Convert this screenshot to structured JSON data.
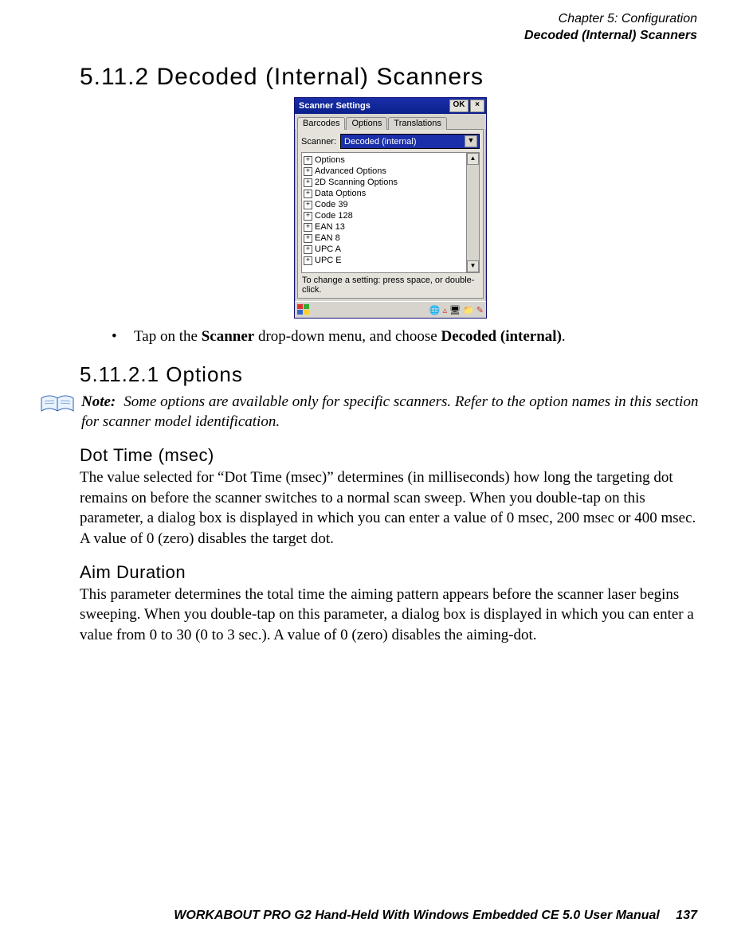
{
  "header": {
    "chapter": "Chapter 5: Configuration",
    "section_name": "Decoded (Internal) Scanners"
  },
  "h_5_11_2": "5.11.2  Decoded (Internal) Scanners",
  "instruction": {
    "pre": "Tap on the ",
    "bold1": "Scanner",
    "mid": " drop-down menu, and choose ",
    "bold2": "Decoded (internal)",
    "post": "."
  },
  "h_5_11_2_1": "5.11.2.1  Options",
  "note": {
    "label": "Note:",
    "text": "Some options are available only for specific scanners. Refer to the option names in this section for scanner model identification."
  },
  "dot_time": {
    "heading": "Dot Time (msec)",
    "body": "The value selected for “Dot Time (msec)” determines (in milliseconds) how long the targeting dot remains on before the scanner switches to a normal scan sweep. When you double-tap on this parameter, a dialog box is displayed in which you can enter a value of 0 msec, 200 msec or 400 msec. A value of 0 (zero) disables the target dot."
  },
  "aim": {
    "heading": "Aim Duration",
    "body": "This parameter determines the total time the aiming pattern appears before the scanner laser begins sweeping. When you double-tap on this parameter, a dialog box is displayed in which you can enter a value from 0 to 30 (0 to 3 sec.). A value of 0 (zero) disables the aiming-dot."
  },
  "footer": {
    "title": "WORKABOUT PRO G2 Hand-Held With Windows Embedded CE 5.0 User Manual",
    "page": "137"
  },
  "dialog": {
    "title": "Scanner Settings",
    "ok": "OK",
    "close": "×",
    "tabs": {
      "barcodes": "Barcodes",
      "options": "Options",
      "translations": "Translations"
    },
    "scanner_label": "Scanner:",
    "scanner_value": "Decoded (internal)",
    "tree": [
      "Options",
      "Advanced Options",
      "2D Scanning Options",
      "Data Options",
      "Code 39",
      "Code 128",
      "EAN 13",
      "EAN 8",
      "UPC A",
      "UPC E"
    ],
    "hint": "To change a setting: press space, or double-click."
  }
}
